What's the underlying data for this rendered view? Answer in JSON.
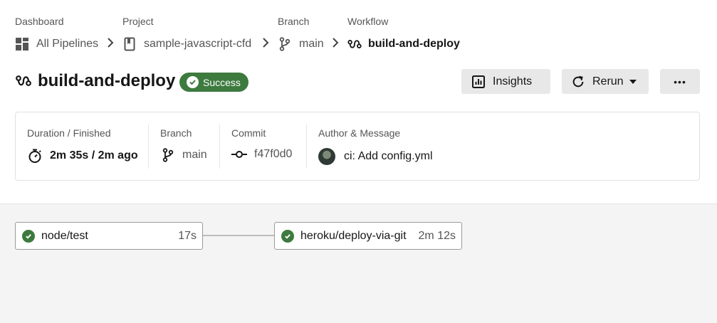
{
  "breadcrumb": {
    "dashboard": {
      "label": "Dashboard",
      "value": "All Pipelines",
      "icon": "grid-icon"
    },
    "project": {
      "label": "Project",
      "value": "sample-javascript-cfd",
      "icon": "repo-icon"
    },
    "branch": {
      "label": "Branch",
      "value": "main",
      "icon": "branch-icon"
    },
    "workflow": {
      "label": "Workflow",
      "value": "build-and-deploy",
      "icon": "workflow-icon"
    }
  },
  "header": {
    "title": "build-and-deploy",
    "status": "Success",
    "status_color": "#3d7a3e"
  },
  "actions": {
    "insights": "Insights",
    "rerun": "Rerun",
    "more": "•••"
  },
  "info": {
    "duration_label": "Duration / Finished",
    "duration_value": "2m 35s / 2m ago",
    "branch_label": "Branch",
    "branch_value": "main",
    "commit_label": "Commit",
    "commit_value": "f47f0d0",
    "author_label": "Author & Message",
    "message": "ci: Add config.yml"
  },
  "jobs": [
    {
      "name": "node/test",
      "duration": "17s",
      "status": "success"
    },
    {
      "name": "heroku/deploy-via-git",
      "duration": "2m 12s",
      "status": "success"
    }
  ]
}
